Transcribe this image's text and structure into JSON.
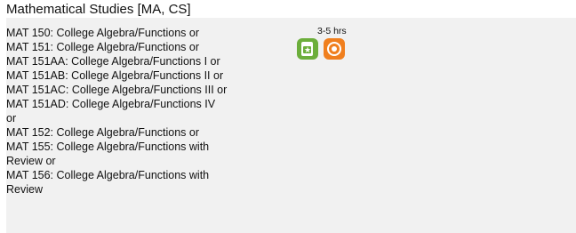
{
  "section": {
    "title": "Mathematical Studies [MA, CS]"
  },
  "courses": [
    "MAT 150: College Algebra/Functions or",
    "MAT 151: College Algebra/Functions or",
    "MAT 151AA: College Algebra/Functions I or",
    "MAT 151AB: College Algebra/Functions II or",
    "MAT 151AC: College Algebra/Functions III or",
    "MAT 151AD: College Algebra/Functions IV",
    "or",
    "MAT 152: College Algebra/Functions or",
    "MAT 155: College Algebra/Functions with",
    "Review or",
    "MAT 156: College Algebra/Functions with",
    "Review"
  ],
  "credit": {
    "hours": "3-5 hrs"
  },
  "icons": {
    "online": "online-course-icon",
    "ring": "hybrid-course-icon"
  },
  "colors": {
    "panel_bg": "#f1f1f1",
    "online_badge": "#6cae3b",
    "ring_badge": "#f07f1e"
  }
}
